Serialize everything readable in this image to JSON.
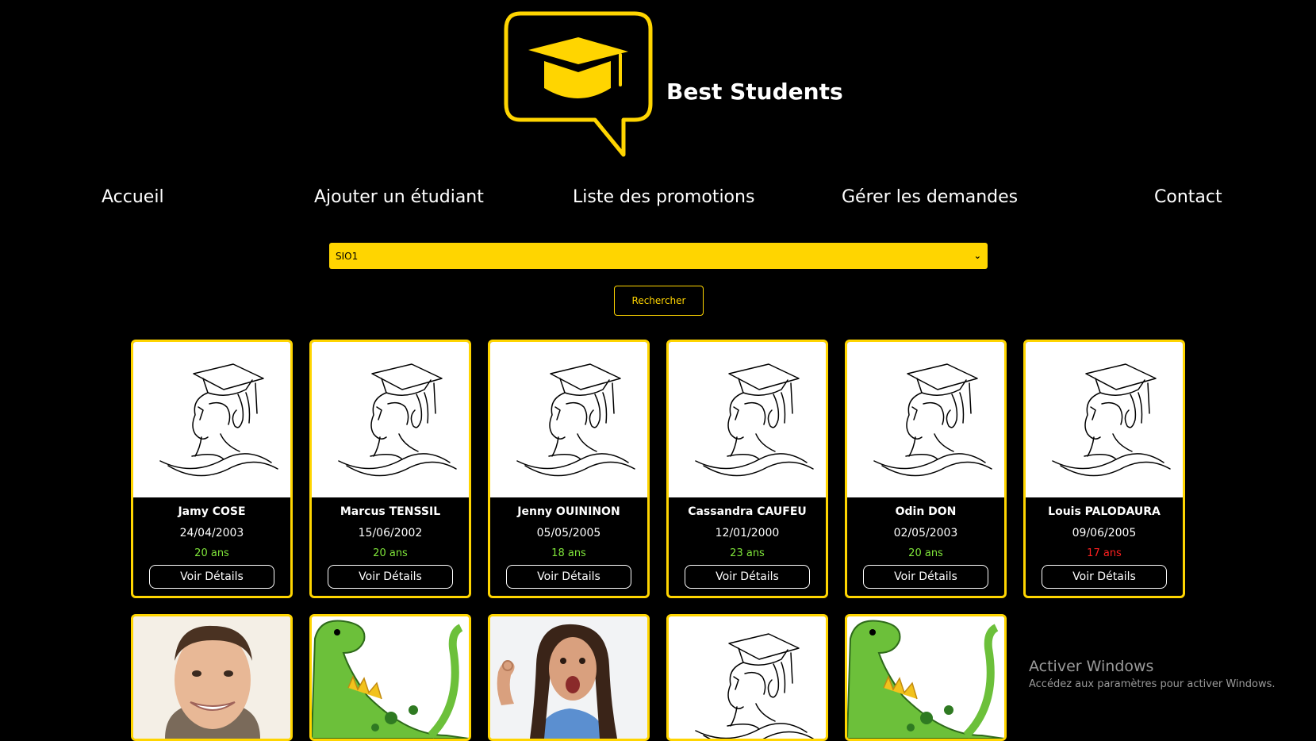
{
  "brand": {
    "name": "Best Students",
    "logo_icon": "graduation-cap-chat-bubble-icon"
  },
  "nav": {
    "items": [
      {
        "label": "Accueil"
      },
      {
        "label": "Ajouter un étudiant"
      },
      {
        "label": "Liste des promotions"
      },
      {
        "label": "Gérer les demandes"
      },
      {
        "label": "Contact"
      }
    ]
  },
  "filter": {
    "selected": "SIO1",
    "search_label": "Rechercher"
  },
  "students": [
    {
      "name": "Jamy COSE",
      "dob": "24/04/2003",
      "age": "20 ans",
      "status_color": "#7fe53a",
      "details_label": "Voir Détails"
    },
    {
      "name": "Marcus TENSSIL",
      "dob": "15/06/2002",
      "age": "20 ans",
      "status_color": "#7fe53a",
      "details_label": "Voir Détails"
    },
    {
      "name": "Jenny OUININON",
      "dob": "05/05/2005",
      "age": "18 ans",
      "status_color": "#7fe53a",
      "details_label": "Voir Détails"
    },
    {
      "name": "Cassandra CAUFEU",
      "dob": "12/01/2000",
      "age": "23 ans",
      "status_color": "#7fe53a",
      "details_label": "Voir Détails"
    },
    {
      "name": "Odin DON",
      "dob": "02/05/2003",
      "age": "20 ans",
      "status_color": "#7fe53a",
      "details_label": "Voir Détails"
    },
    {
      "name": "Louis PALODAURA",
      "dob": "09/06/2005",
      "age": "17 ans",
      "status_color": "#ff2020",
      "details_label": "Voir Détails"
    }
  ],
  "second_row_photos": [
    {
      "kind": "man-portrait-photo"
    },
    {
      "kind": "green-dinosaur-illustration"
    },
    {
      "kind": "woman-ok-gesture-photo"
    },
    {
      "kind": "graduate-line-drawing"
    },
    {
      "kind": "green-dinosaur-illustration"
    }
  ],
  "watermark": {
    "title": "Activer Windows",
    "subtitle": "Accédez aux paramètres pour activer Windows."
  },
  "colors": {
    "accent": "#ffd500",
    "background": "#000000",
    "age_ok": "#7fe53a",
    "age_minor": "#ff2020"
  }
}
